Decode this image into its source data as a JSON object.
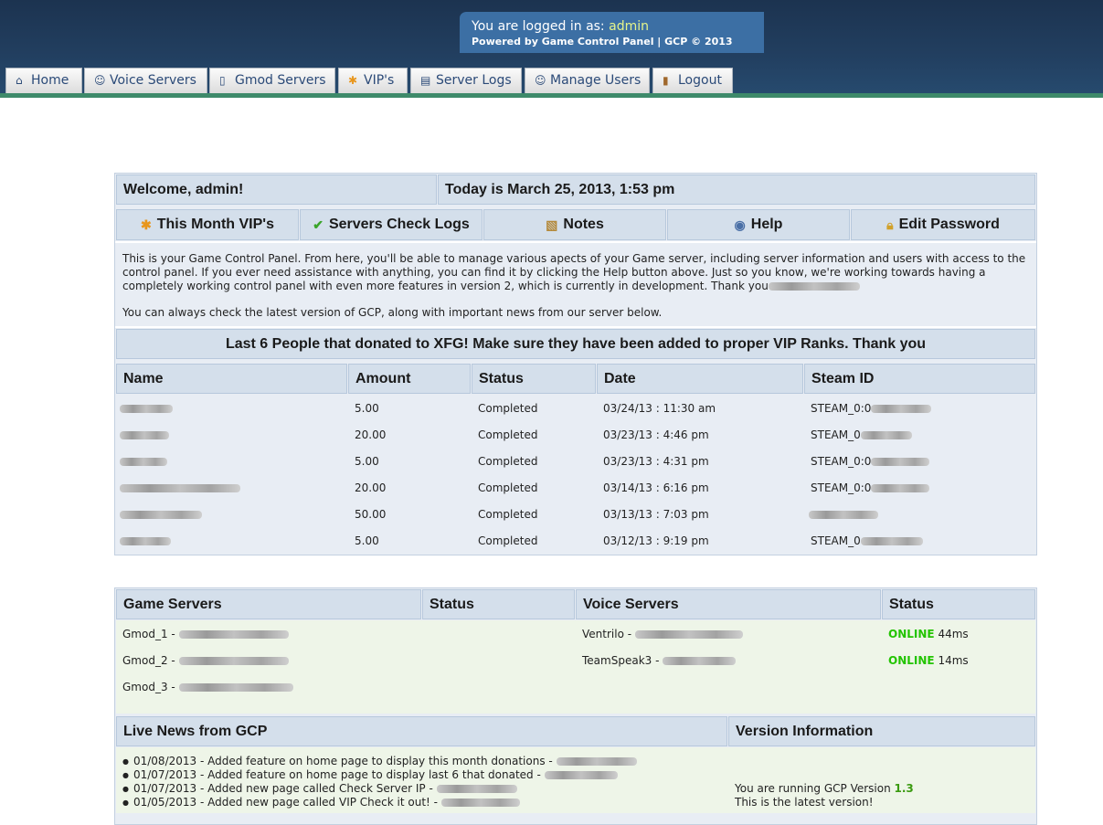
{
  "header": {
    "logged_in_label": "You are logged in as: ",
    "username": "admin",
    "powered_by": "Powered by Game Control Panel | GCP © 2013"
  },
  "tabs": [
    {
      "label": "Home",
      "icon": "home-icon"
    },
    {
      "label": "Voice Servers",
      "icon": "user-icon"
    },
    {
      "label": "Gmod Servers",
      "icon": "server-icon"
    },
    {
      "label": "VIP's",
      "icon": "star-icon"
    },
    {
      "label": "Server Logs",
      "icon": "log-icon"
    },
    {
      "label": "Manage Users",
      "icon": "users-icon"
    },
    {
      "label": "Logout",
      "icon": "door-icon"
    }
  ],
  "welcome": {
    "greeting": "Welcome, admin!",
    "date": "Today is March 25, 2013, 1:53 pm"
  },
  "menu": [
    {
      "label": "This Month VIP's",
      "icon": "star-icon"
    },
    {
      "label": "Servers Check Logs",
      "icon": "check-icon"
    },
    {
      "label": "Notes",
      "icon": "notes-icon"
    },
    {
      "label": "Help",
      "icon": "help-icon"
    },
    {
      "label": "Edit Password",
      "icon": "lock-icon"
    }
  ],
  "intro": {
    "paragraph1": "This is your Game Control Panel. From here, you'll be able to manage various apects of your Game server, including server information and users with access to the control panel. If you ever need assistance with anything, you can find it by clicking the Help button above. Just so you know, we're working towards having a completely working control panel with even more features in version 2, which is currently in development. Thank you",
    "paragraph2": "You can always check the latest version of GCP, along with important news from our server below."
  },
  "donations": {
    "title": "Last 6 People that donated to XFG! Make sure they have been added to proper VIP Ranks. Thank you",
    "columns": [
      "Name",
      "Amount",
      "Status",
      "Date",
      "Steam ID"
    ],
    "rows": [
      {
        "amount": "5.00",
        "status": "Completed",
        "date": "03/24/13 : 11:30 am",
        "steam": "STEAM_0:0"
      },
      {
        "amount": "20.00",
        "status": "Completed",
        "date": "03/23/13 : 4:46 pm",
        "steam": "STEAM_0"
      },
      {
        "amount": "5.00",
        "status": "Completed",
        "date": "03/23/13 : 4:31 pm",
        "steam": "STEAM_0:0"
      },
      {
        "amount": "20.00",
        "status": "Completed",
        "date": "03/14/13 : 6:16 pm",
        "steam": "STEAM_0:0"
      },
      {
        "amount": "50.00",
        "status": "Completed",
        "date": "03/13/13 : 7:03 pm",
        "steam": ""
      },
      {
        "amount": "5.00",
        "status": "Completed",
        "date": "03/12/13 : 9:19 pm",
        "steam": "STEAM_0"
      }
    ]
  },
  "servers": {
    "columns": [
      "Game Servers",
      "Status",
      "Voice Servers",
      "Status"
    ],
    "game": [
      "Gmod_1 -",
      "Gmod_2 -",
      "Gmod_3 -"
    ],
    "voice": [
      {
        "name": "Ventrilo -",
        "status": "ONLINE",
        "ping": "44ms"
      },
      {
        "name": "TeamSpeak3 -",
        "status": "ONLINE",
        "ping": "14ms"
      }
    ]
  },
  "news": {
    "title": "Live News from GCP",
    "items": [
      "01/08/2013 - Added feature on home page to display this month donations -",
      "01/07/2013 - Added feature on home page to display last 6 that donated -",
      "01/07/2013 - Added new page called Check Server IP -",
      "01/05/2013 - Added new page called VIP Check it out! -"
    ]
  },
  "version": {
    "title": "Version Information",
    "running_label": "You are running GCP Version ",
    "number": "1.3",
    "latest": "This is the latest version!"
  },
  "colors": {
    "online": "#22c400",
    "header_bg": "#1c3350",
    "panel_bg": "#e8edf4"
  }
}
